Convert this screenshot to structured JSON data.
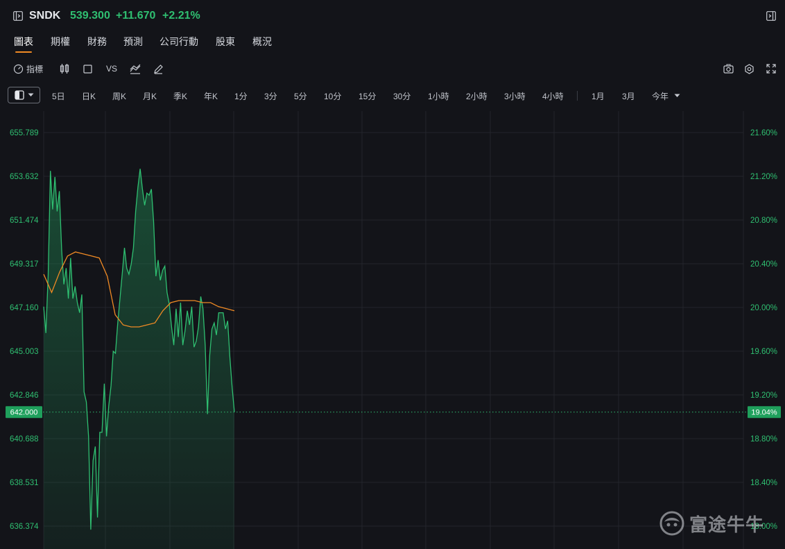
{
  "header": {
    "ticker": "SNDK",
    "price": "539.300",
    "change": "+11.670",
    "change_pct": "+2.21%",
    "up_color": "#2fbf71"
  },
  "tabs": [
    {
      "label": "圖表",
      "active": true
    },
    {
      "label": "期權",
      "active": false
    },
    {
      "label": "財務",
      "active": false
    },
    {
      "label": "預測",
      "active": false
    },
    {
      "label": "公司行動",
      "active": false
    },
    {
      "label": "股東",
      "active": false
    },
    {
      "label": "概況",
      "active": false
    }
  ],
  "toolbar": {
    "indicators_label": "指標",
    "vs_label": "VS"
  },
  "periods": [
    "5日",
    "日K",
    "周K",
    "月K",
    "季K",
    "年K",
    "1分",
    "3分",
    "5分",
    "10分",
    "15分",
    "30分",
    "1小時",
    "2小時",
    "3小時",
    "4小時",
    "1月",
    "3月",
    "今年"
  ],
  "chart_data": {
    "type": "line",
    "y_left_ticks": [
      "655.789",
      "653.632",
      "651.474",
      "649.317",
      "647.160",
      "645.003",
      "642.846",
      "640.688",
      "638.531",
      "636.374"
    ],
    "y_right_ticks": [
      "21.60%",
      "21.20%",
      "20.80%",
      "20.40%",
      "20.00%",
      "19.60%",
      "19.20%",
      "18.80%",
      "18.40%",
      "18.00%"
    ],
    "ylim": [
      636.374,
      655.789
    ],
    "current_price": "642.000",
    "current_pct": "19.04%",
    "grid": true,
    "series": [
      {
        "color": "#2fbf71",
        "values": [
          647.2,
          645.9,
          648.8,
          653.9,
          652.0,
          653.6,
          651.9,
          652.9,
          650.0,
          648.3,
          649.1,
          647.6,
          649.6,
          647.6,
          648.2,
          647.4,
          646.9,
          647.8,
          643.0,
          642.5,
          640.8,
          636.2,
          639.6,
          640.3,
          636.8,
          641.0,
          641.0,
          643.4,
          640.8,
          642.3,
          643.3,
          645.0,
          644.9,
          646.4,
          647.6,
          648.8,
          650.1,
          649.1,
          648.8,
          649.3,
          650.1,
          651.9,
          653.1,
          654.0,
          653.0,
          652.2,
          652.8,
          652.7,
          653.0,
          651.4,
          648.7,
          649.5,
          648.5,
          649.0,
          649.2,
          647.9,
          647.3,
          646.2,
          645.3,
          647.1,
          645.7,
          647.4,
          645.3,
          646.0,
          647.0,
          646.3,
          647.2,
          645.2,
          645.5,
          646.2,
          647.7,
          647.1,
          645.3,
          641.9,
          644.8,
          646.1,
          646.4,
          645.8,
          646.9,
          646.9,
          646.9,
          646.1,
          646.5,
          644.7,
          643.2,
          642.0
        ],
        "note": ""
      },
      {
        "color": "#f08a24",
        "values": [
          648.8,
          647.9,
          648.9,
          649.7,
          649.9,
          649.8,
          649.7,
          649.6,
          648.7,
          646.8,
          646.3,
          646.2,
          646.2,
          646.3,
          646.4,
          647.0,
          647.4,
          647.5,
          647.5,
          647.5,
          647.4,
          647.4,
          647.2,
          647.1,
          647.0
        ]
      }
    ]
  }
}
